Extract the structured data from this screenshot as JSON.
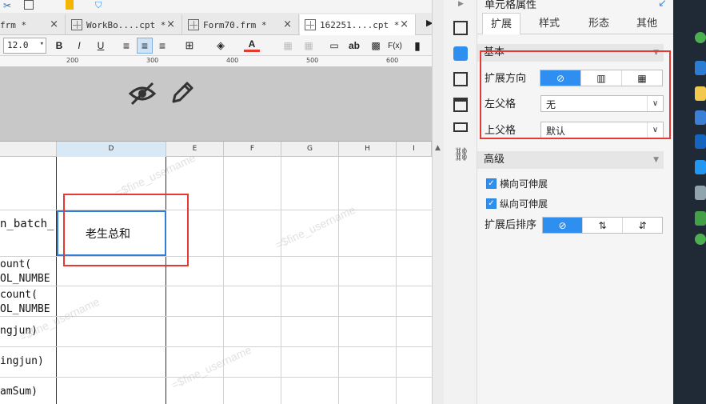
{
  "document_tabs": [
    {
      "label": "frm *",
      "close": "×"
    },
    {
      "label": "WorkBo....cpt *",
      "close": "×"
    },
    {
      "label": "Form70.frm *",
      "close": "×"
    },
    {
      "label": "162251....cpt *",
      "close": "×"
    }
  ],
  "font_size": "12.0",
  "format_buttons": {
    "bold": "B",
    "italic": "I",
    "underline": "U",
    "font_color": "A",
    "text_label": "ab",
    "formula": "F(x)"
  },
  "ruler_marks": [
    "200",
    "300",
    "400",
    "500",
    "600"
  ],
  "columns": [
    "D",
    "E",
    "F",
    "G",
    "H",
    "I"
  ],
  "cells": {
    "row2_c": "n_batch_",
    "row2_d": "老生总和",
    "row3_line1": "ount(",
    "row3_line2": "OL_NUMBE",
    "row4_line1": "count(",
    "row4_line2": "OL_NUMBE",
    "row5": "ngjun)",
    "row6": "ingjun)",
    "row7": "amSum)"
  },
  "watermark": "=$fine_username",
  "panel": {
    "title": "单元格属性",
    "tabs": [
      "扩展",
      "样式",
      "形态",
      "其他"
    ],
    "active_tab": "扩展",
    "basic_section": "基本",
    "expand_direction_label": "扩展方向",
    "left_parent_label": "左父格",
    "left_parent_value": "无",
    "upper_parent_label": "上父格",
    "upper_parent_value": "默认",
    "advanced_section": "高级",
    "horizontal_extendable": "横向可伸展",
    "vertical_extendable": "纵向可伸展",
    "sort_after_expand_label": "扩展后排序"
  },
  "colors": {
    "accent": "#2f8ff0",
    "highlight_red": "#e53935",
    "taskbar": "#1f2a36"
  }
}
